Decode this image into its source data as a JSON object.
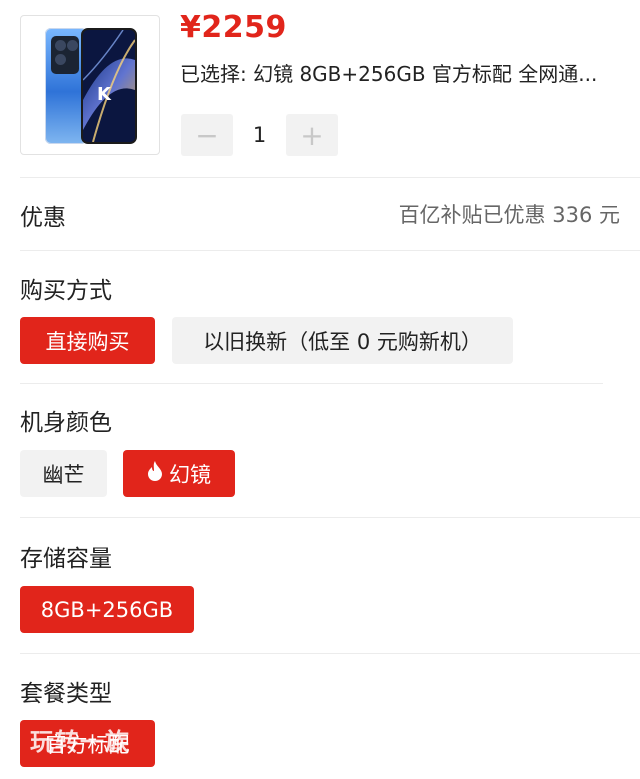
{
  "product": {
    "price": "¥2259",
    "selected_text": "已选择: 幻镜 8GB+256GB 官方标配 全网通...",
    "quantity": "1",
    "minus_symbol": "−",
    "plus_symbol": "+"
  },
  "discount": {
    "label": "优惠",
    "value": "百亿补贴已优惠 336 元"
  },
  "purchase_method": {
    "label": "购买方式",
    "options": [
      {
        "label": "直接购买",
        "selected": true
      },
      {
        "label": "以旧换新（低至 0 元购新机）",
        "selected": false
      }
    ]
  },
  "color": {
    "label": "机身颜色",
    "options": [
      {
        "label": "幽芒",
        "selected": false
      },
      {
        "label": "幻镜",
        "selected": true,
        "icon": "flame-icon"
      }
    ]
  },
  "storage": {
    "label": "存储容量",
    "options": [
      {
        "label": "8GB+256GB",
        "selected": true
      }
    ]
  },
  "package": {
    "label": "套餐类型",
    "options": [
      {
        "label": "官方标配",
        "selected": true
      }
    ]
  },
  "watermark": "玩转一族",
  "colors": {
    "accent": "#e1251b",
    "chip_gray": "#f2f2f2",
    "divider": "#ececec"
  }
}
